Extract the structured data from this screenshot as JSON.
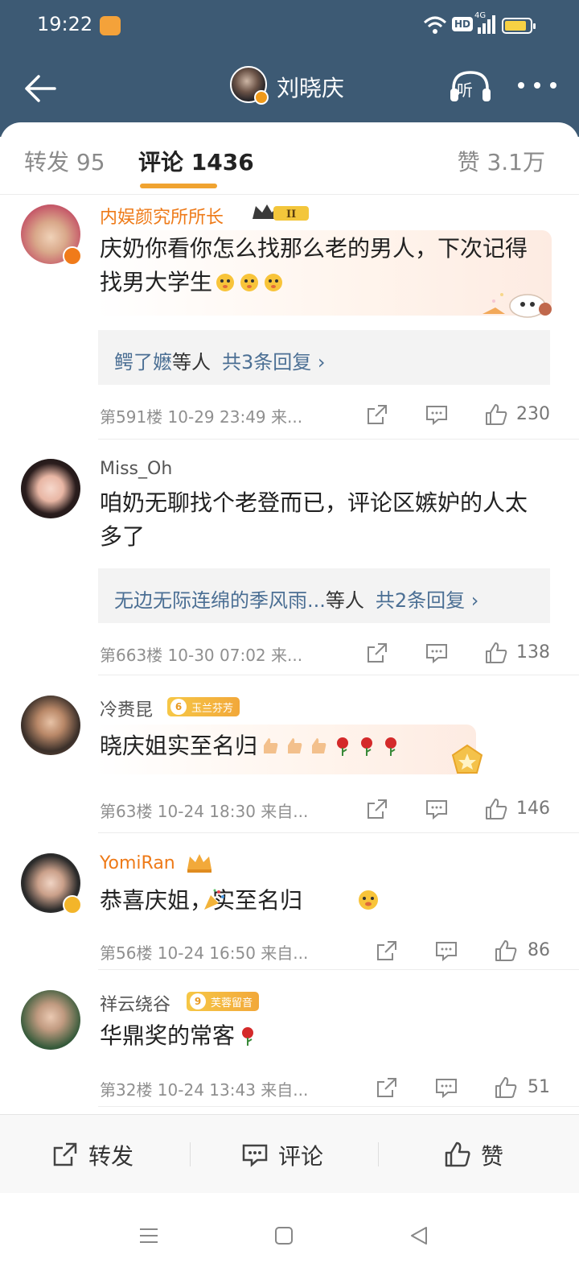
{
  "status_bar": {
    "time": "19:22",
    "network_label": "4G",
    "hd_label": "HD"
  },
  "nav": {
    "user_name": "刘晓庆",
    "listen_label": "听"
  },
  "tabs": {
    "forward": "转发 95",
    "comments": "评论 1436",
    "likes": "赞 3.1万"
  },
  "comments": [
    {
      "name": "内娱颜究所所长",
      "badge": "II",
      "text": "庆奶你看你怎么找那么老的男人，下次记得找男大学生",
      "replies_user": "鳄了嬷",
      "replies_suffix": "等人",
      "replies_count": "共3条回复 ›",
      "meta": "第591楼  10-29 23:49  来...",
      "likes": "230"
    },
    {
      "name": "Miss_Oh",
      "text": "咱奶无聊找个老登而已，评论区嫉妒的人太多了",
      "replies_user": "无边无际连绵的季风雨...",
      "replies_suffix": "等人",
      "replies_count": "共2条回复 ›",
      "meta": "第663楼  10-30 07:02  来...",
      "likes": "138"
    },
    {
      "name": "冷赉昆",
      "badge_num": "6",
      "badge": "玉兰芬芳",
      "text": "晓庆姐实至名归",
      "meta": "第63楼  10-24 18:30  来自...",
      "likes": "146"
    },
    {
      "name": "YomiRan",
      "text": "恭喜庆姐，实至名归",
      "meta": "第56楼  10-24 16:50  来自...",
      "likes": "86"
    },
    {
      "name": "祥云绕谷",
      "badge_num": "9",
      "badge": "芙蓉留音",
      "text": "华鼎奖的常客",
      "meta": "第32楼  10-24 13:43  来自...",
      "likes": "51"
    }
  ],
  "bottom_bar": {
    "forward": "转发",
    "comment": "评论",
    "like": "赞"
  },
  "colors": {
    "header_bg": "#3d5a74",
    "accent": "#f0a330",
    "link": "#4b6f94",
    "vip_name": "#ee7a18"
  }
}
